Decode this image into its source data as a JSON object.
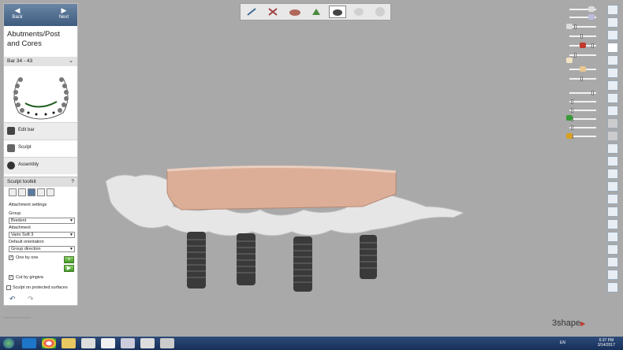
{
  "nav": {
    "back_label": "Back",
    "next_label": "Next"
  },
  "panel": {
    "title": "Abutments/Post and Cores",
    "bar_label": "Bar 34 - 43",
    "workflow": [
      {
        "label": "Edit bar"
      },
      {
        "label": "Sculpt"
      },
      {
        "label": "Assembly"
      }
    ]
  },
  "toolkit": {
    "title": "Sculpt toolkit",
    "help": "?",
    "attachment_settings_label": "Attachment settings",
    "group_label": "Group",
    "group_value": "Bredent",
    "attachment_label": "Attachment",
    "attachment_value": "Vario Soft 3",
    "default_orientation_label": "Default orientation",
    "default_orientation_value": "Group direction",
    "one_by_one_label": "One by one",
    "cut_by_gingiva_label": "Cut by gingiva",
    "sculpt_protected_label": "Sculpt on protected surfaces"
  },
  "brand": "3shape",
  "status_text": "~~~~~~~~~~",
  "clock": {
    "time": "6:37 PM",
    "date": "3/14/2017"
  },
  "tray": {
    "lang": "EN"
  },
  "colors": {
    "accent": "#3e5c7f",
    "bar": "#dcae98",
    "implant": "#3a3a3a",
    "gingiva": "#e6e6e6",
    "background": "#a9a9a9"
  }
}
